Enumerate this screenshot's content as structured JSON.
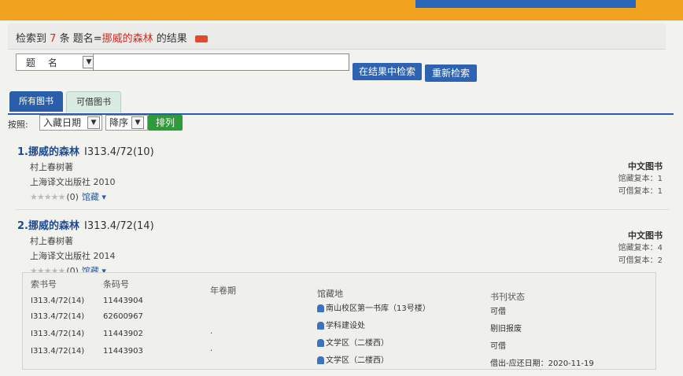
{
  "result": {
    "prefix": "检索到",
    "count": "7",
    "mid": " 条 题名=",
    "term": "挪威的森林",
    "suffix": " 的结果"
  },
  "search": {
    "field": "题 名",
    "query": "",
    "btn_in_results": "在结果中检索",
    "btn_research": "重新检索"
  },
  "tabs": [
    {
      "label": "所有图书"
    },
    {
      "label": "可借图书"
    }
  ],
  "sort": {
    "label": "按照:",
    "by": "入藏日期",
    "order": "降序",
    "button": "排列"
  },
  "books": [
    {
      "title": "1.挪威的森林",
      "call": "I313.4/72(10)",
      "author": "村上春树著",
      "publisher": "上海译文出版社 2010",
      "rating": "(0)",
      "holding_link": "馆藏",
      "type": "中文图书",
      "copies": "馆藏复本：1",
      "available": "可借复本：1"
    },
    {
      "title": "2.挪威的森林",
      "call": "I313.4/72(14)",
      "author": "村上春树著",
      "publisher": "上海译文出版社 2014",
      "rating": "(0)",
      "holding_link": "馆藏",
      "type": "中文图书",
      "copies": "馆藏复本：4",
      "available": "可借复本：2"
    }
  ],
  "holdings": {
    "headers": [
      "索书号",
      "条码号",
      "年卷期",
      "馆藏地",
      "书刊状态"
    ],
    "rows": [
      {
        "call": "I313.4/72(14)",
        "barcode": "11443904",
        "vol": "",
        "loc": "南山校区第一书库（13号楼）",
        "status": "可借"
      },
      {
        "call": "I313.4/72(14)",
        "barcode": "62600967",
        "vol": "",
        "loc": "学科建设处",
        "status": "剔旧报废"
      },
      {
        "call": "I313.4/72(14)",
        "barcode": "11443902",
        "vol": "",
        "loc": "文学区（二楼西）",
        "status": "可借"
      },
      {
        "call": "I313.4/72(14)",
        "barcode": "11443903",
        "vol": "",
        "loc": "文学区（二楼西）",
        "status": "借出-应还日期：2020-11-19"
      }
    ]
  }
}
